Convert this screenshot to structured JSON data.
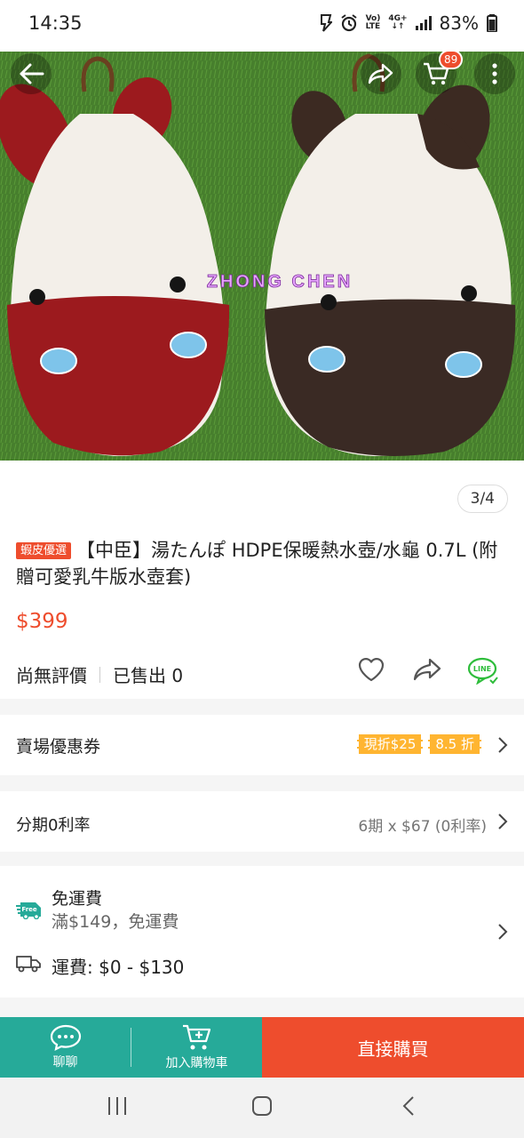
{
  "status_bar": {
    "time": "14:35",
    "volte_top": "Vo)",
    "volte_bottom": "LTE",
    "network_top": "4G+",
    "network_bottom": "↓↑",
    "battery": "83%"
  },
  "hero": {
    "watermark": "ZHONG CHEN",
    "cart_count": "89",
    "page_counter": "3/4",
    "icons": [
      "back-arrow-icon",
      "share-icon",
      "cart-icon",
      "more-icon"
    ]
  },
  "product": {
    "mall_badge": "蝦皮優選",
    "title": "【中臣】湯たんぽ HDPE保暖熱水壺/水龜 0.7L (附贈可愛乳牛版水壺套)",
    "price": "$399",
    "rating_text": "尚無評價",
    "sold_text": "已售出 0"
  },
  "voucher_row": {
    "label": "賣場優惠券",
    "vouchers": [
      "現折$25",
      "8.5 折"
    ]
  },
  "installment_row": {
    "label": "分期0利率",
    "value": "6期 x $67 (0利率)"
  },
  "shipping": {
    "free_label": "免運費",
    "free_detail": "滿$149，免運費",
    "free_badge": "Free",
    "fee_label": "運費: $0 - $130"
  },
  "bottom_bar": {
    "chat_label": "聊聊",
    "add_cart_label": "加入購物車",
    "buy_now_label": "直接購買"
  },
  "colors": {
    "brand": "#ee4d2d",
    "teal": "#26aa99",
    "voucher": "#ffb531"
  }
}
